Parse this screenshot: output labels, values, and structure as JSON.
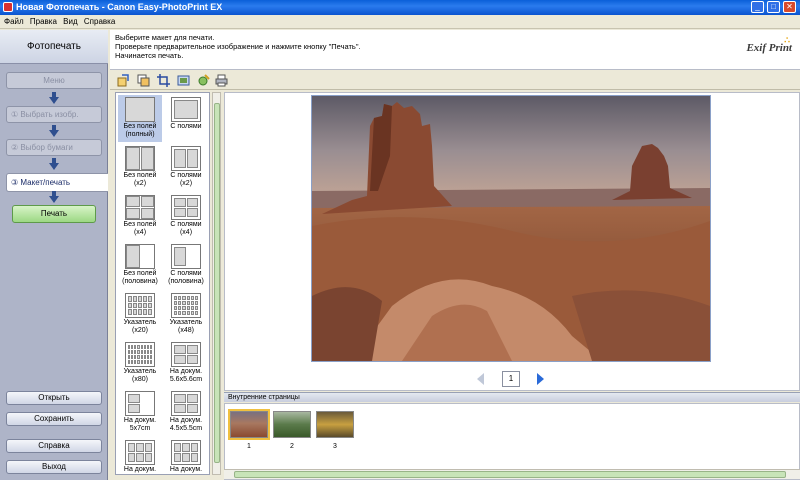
{
  "window": {
    "title": "Новая Фотопечать - Canon Easy-PhotoPrint EX",
    "minimize": "_",
    "maximize": "□",
    "close": "✕"
  },
  "menu": [
    "Файл",
    "Правка",
    "Вид",
    "Справка"
  ],
  "sidebar": {
    "header": "Фотопечать",
    "steps": [
      {
        "label": "Меню"
      },
      {
        "label": "① Выбрать изобр."
      },
      {
        "label": "② Выбор бумаги"
      }
    ],
    "current_step": "③ Макет/печать",
    "print_button": "Печать",
    "open_button": "Открыть",
    "save_button": "Сохранить",
    "help_button": "Справка",
    "exit_button": "Выход"
  },
  "info": {
    "line1": "Выберите макет для печати.",
    "line2": "Проверьте предварительное изображение и нажмите кнопку \"Печать\".",
    "line3": "Начинается печать.",
    "logo": "Exif Print"
  },
  "toolbar_icons": [
    "rotate-icon",
    "layout-icon",
    "crop-icon",
    "frame-icon",
    "correct-icon",
    "print-settings-icon"
  ],
  "layouts": [
    {
      "label": "Без полей (полный)",
      "selected": true
    },
    {
      "label": "С полями",
      "selected": false
    },
    {
      "label": "Без полей (x2)",
      "selected": false
    },
    {
      "label": "С полями (x2)",
      "selected": false
    },
    {
      "label": "Без полей (x4)",
      "selected": false
    },
    {
      "label": "С полями (x4)",
      "selected": false
    },
    {
      "label": "Без полей (половина)",
      "selected": false
    },
    {
      "label": "С полями (половина)",
      "selected": false
    },
    {
      "label": "Указатель (x20)",
      "selected": false
    },
    {
      "label": "Указатель (x48)",
      "selected": false
    },
    {
      "label": "Указатель (x80)",
      "selected": false
    },
    {
      "label": "На докум. 5.6x5.6cm",
      "selected": false
    },
    {
      "label": "На докум. 5x7cm",
      "selected": false
    },
    {
      "label": "На докум. 4.5x5.5cm",
      "selected": false
    },
    {
      "label": "На докум.",
      "selected": false
    },
    {
      "label": "На докум.",
      "selected": false
    }
  ],
  "pager": {
    "page": "1"
  },
  "pages": {
    "title": "Внутренние страницы",
    "items": [
      "1",
      "2",
      "3"
    ]
  }
}
